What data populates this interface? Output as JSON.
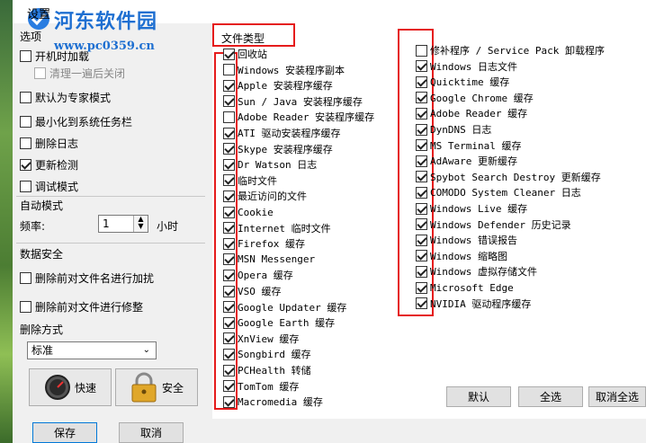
{
  "window": {
    "title": "设置"
  },
  "watermark": {
    "line1": "河东软件园",
    "line2": "www.pc0359.cn"
  },
  "left": {
    "tab": "选项",
    "options": [
      {
        "label": "开机时加载",
        "checked": false,
        "disabled": false
      },
      {
        "label": "清理一遍后关闭",
        "checked": false,
        "disabled": true
      },
      {
        "label": "默认为专家模式",
        "checked": false,
        "disabled": false
      },
      {
        "label": "最小化到系统任务栏",
        "checked": false,
        "disabled": false
      },
      {
        "label": "删除日志",
        "checked": false,
        "disabled": false
      },
      {
        "label": "更新检测",
        "checked": true,
        "disabled": false
      },
      {
        "label": "调试模式",
        "checked": false,
        "disabled": false
      }
    ],
    "auto_mode": {
      "title": "自动模式",
      "freq_label": "频率:",
      "freq_value": "1",
      "freq_unit": "小时"
    },
    "data_security": {
      "title": "数据安全",
      "options": [
        {
          "label": "删除前对文件名进行加扰",
          "checked": false
        },
        {
          "label": "删除前对文件进行修整",
          "checked": false
        }
      ]
    },
    "delete_method": {
      "title": "删除方式",
      "selected": "标准"
    },
    "mode_buttons": {
      "fast": "快速",
      "safe": "安全"
    },
    "footer": {
      "save": "保存",
      "cancel": "取消"
    }
  },
  "file_types": {
    "header": "文件类型",
    "col1": [
      {
        "label": "回收站",
        "checked": true
      },
      {
        "label": "Windows 安装程序副本",
        "checked": false
      },
      {
        "label": "Apple 安装程序缓存",
        "checked": true
      },
      {
        "label": "Sun / Java 安装程序缓存",
        "checked": true
      },
      {
        "label": "Adobe Reader 安装程序缓存",
        "checked": false
      },
      {
        "label": "ATI 驱动安装程序缓存",
        "checked": true
      },
      {
        "label": "Skype 安装程序缓存",
        "checked": true
      },
      {
        "label": "Dr Watson 日志",
        "checked": true
      },
      {
        "label": "临时文件",
        "checked": true
      },
      {
        "label": "最近访问的文件",
        "checked": true
      },
      {
        "label": "Cookie",
        "checked": true
      },
      {
        "label": "Internet 临时文件",
        "checked": true
      },
      {
        "label": "Firefox 缓存",
        "checked": true
      },
      {
        "label": "MSN Messenger",
        "checked": true
      },
      {
        "label": "Opera 缓存",
        "checked": true
      },
      {
        "label": "VSO 缓存",
        "checked": true
      },
      {
        "label": "Google Updater 缓存",
        "checked": true
      },
      {
        "label": "Google Earth 缓存",
        "checked": true
      },
      {
        "label": "XnView 缓存",
        "checked": true
      },
      {
        "label": "Songbird 缓存",
        "checked": true
      },
      {
        "label": "PCHealth 转储",
        "checked": true
      },
      {
        "label": "TomTom 缓存",
        "checked": true
      },
      {
        "label": "Macromedia 缓存",
        "checked": true
      }
    ],
    "col2": [
      {
        "label": "修补程序 / Service Pack 卸载程序",
        "checked": false
      },
      {
        "label": "Windows 日志文件",
        "checked": true
      },
      {
        "label": "Quicktime 缓存",
        "checked": true
      },
      {
        "label": "Google Chrome 缓存",
        "checked": true
      },
      {
        "label": "Adobe Reader 缓存",
        "checked": true
      },
      {
        "label": "DynDNS 日志",
        "checked": true
      },
      {
        "label": "MS Terminal 缓存",
        "checked": true
      },
      {
        "label": "AdAware 更新缓存",
        "checked": true
      },
      {
        "label": "Spybot Search  Destroy 更新缓存",
        "checked": true
      },
      {
        "label": "COMODO System Cleaner 日志",
        "checked": true
      },
      {
        "label": "Windows Live 缓存",
        "checked": true
      },
      {
        "label": "Windows Defender 历史记录",
        "checked": true
      },
      {
        "label": "Windows 错误报告",
        "checked": true
      },
      {
        "label": "Windows 缩略图",
        "checked": true
      },
      {
        "label": "Windows 虚拟存储文件",
        "checked": true
      },
      {
        "label": "Microsoft Edge",
        "checked": true
      },
      {
        "label": "NVIDIA 驱动程序缓存",
        "checked": true
      }
    ],
    "buttons": {
      "default": "默认",
      "select_all": "全选",
      "deselect_all": "取消全选"
    }
  }
}
